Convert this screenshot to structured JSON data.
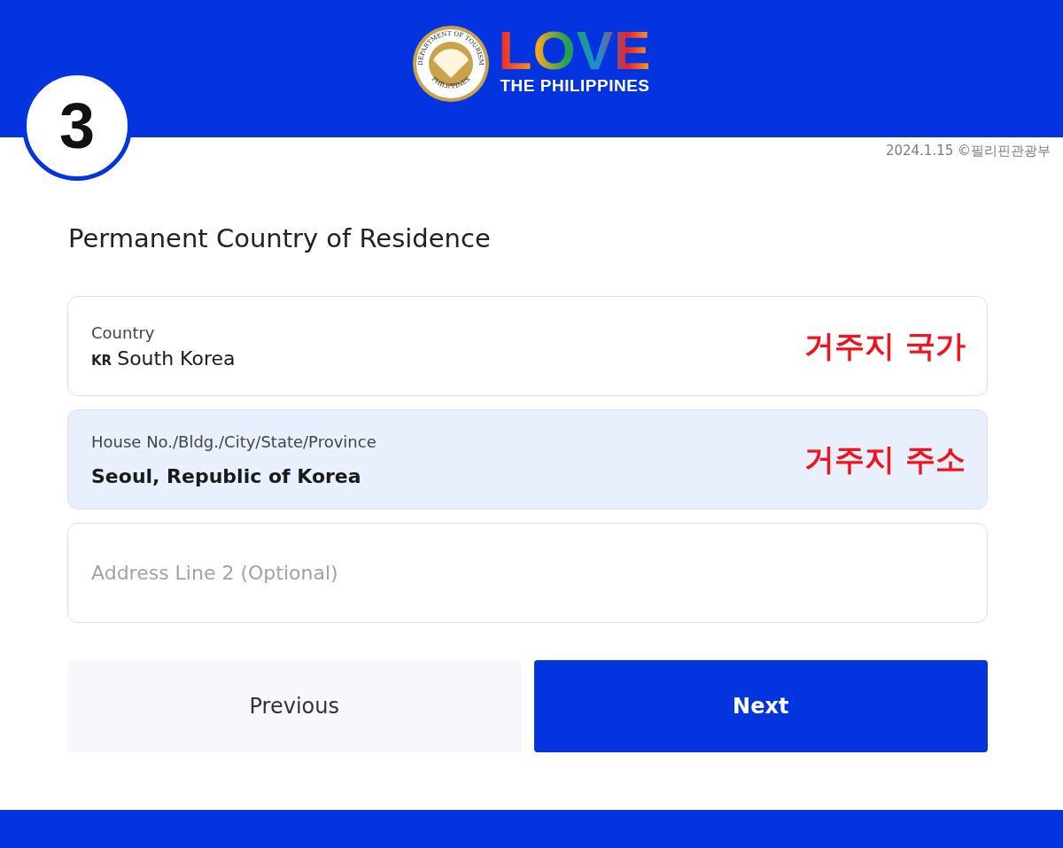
{
  "header": {
    "step": "3",
    "seal": {
      "top": "DEPARTMENT OF TOURISM",
      "bottom": "PHILIPPINES"
    },
    "logo": {
      "word": "LOVE",
      "tagline": "THE PHILIPPINES"
    }
  },
  "credit": "2024.1.15 ©필리핀관광부",
  "title": "Permanent Country of Residence",
  "fields": [
    {
      "kind": "select",
      "label": "Country",
      "code": "KR",
      "value": "South Korea",
      "highlighted": false,
      "annotation": "거주지 국가"
    },
    {
      "kind": "text",
      "label": "House No./Bldg./City/State/Province",
      "value": "Seoul, Republic of Korea",
      "highlighted": true,
      "annotation": "거주지 주소"
    },
    {
      "kind": "text",
      "placeholder": "Address Line 2 (Optional)",
      "highlighted": false
    }
  ],
  "buttons": [
    {
      "kind": "secondary",
      "label": "Previous"
    },
    {
      "kind": "primary",
      "label": "Next"
    }
  ]
}
